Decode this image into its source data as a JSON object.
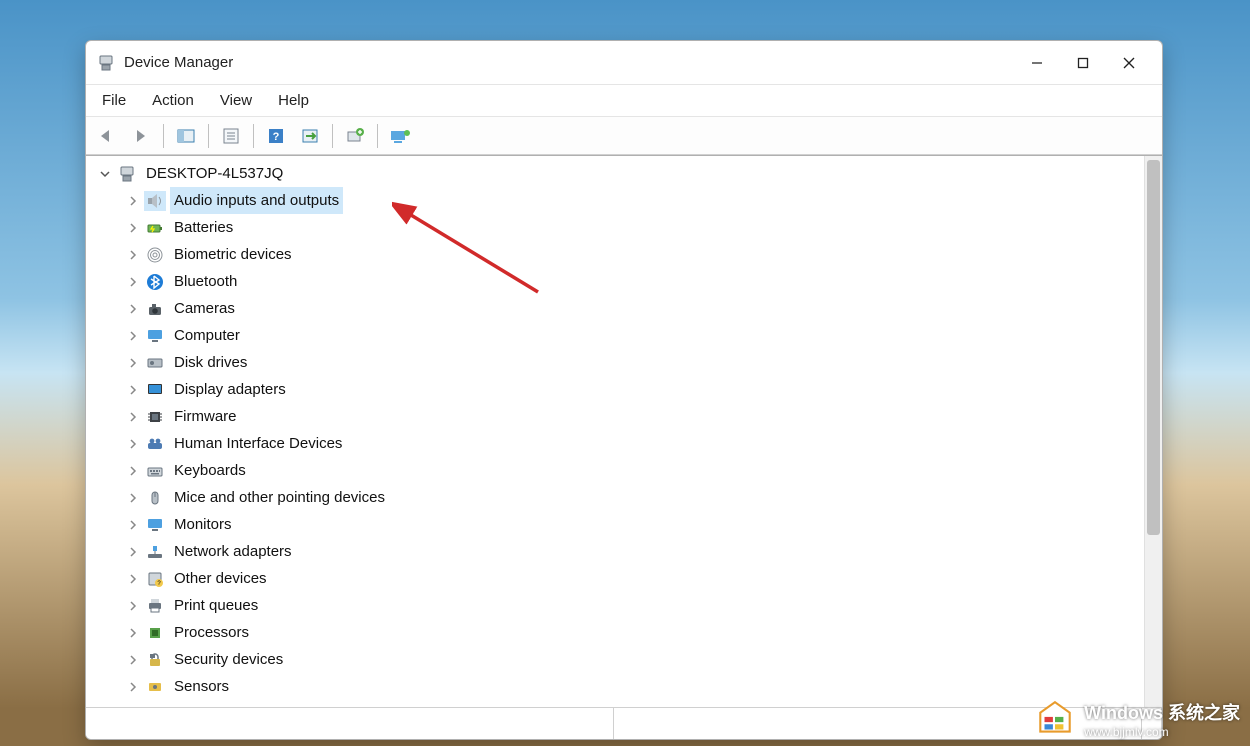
{
  "window": {
    "title": "Device Manager"
  },
  "menubar": {
    "file": "File",
    "action": "Action",
    "view": "View",
    "help": "Help"
  },
  "tree": {
    "root": {
      "label": "DESKTOP-4L537JQ",
      "expanded": true
    },
    "categories": [
      {
        "label": "Audio inputs and outputs",
        "icon": "speaker",
        "selected": true
      },
      {
        "label": "Batteries",
        "icon": "battery"
      },
      {
        "label": "Biometric devices",
        "icon": "fingerprint"
      },
      {
        "label": "Bluetooth",
        "icon": "bluetooth"
      },
      {
        "label": "Cameras",
        "icon": "camera"
      },
      {
        "label": "Computer",
        "icon": "monitor"
      },
      {
        "label": "Disk drives",
        "icon": "disk"
      },
      {
        "label": "Display adapters",
        "icon": "display"
      },
      {
        "label": "Firmware",
        "icon": "chip"
      },
      {
        "label": "Human Interface Devices",
        "icon": "hid"
      },
      {
        "label": "Keyboards",
        "icon": "keyboard"
      },
      {
        "label": "Mice and other pointing devices",
        "icon": "mouse"
      },
      {
        "label": "Monitors",
        "icon": "monitor"
      },
      {
        "label": "Network adapters",
        "icon": "network"
      },
      {
        "label": "Other devices",
        "icon": "unknown"
      },
      {
        "label": "Print queues",
        "icon": "printer"
      },
      {
        "label": "Processors",
        "icon": "cpu"
      },
      {
        "label": "Security devices",
        "icon": "lock"
      },
      {
        "label": "Sensors",
        "icon": "sensor"
      }
    ]
  },
  "watermark": {
    "line1": "Windows 系统之家",
    "line2": "www.bjjmlv.com"
  }
}
